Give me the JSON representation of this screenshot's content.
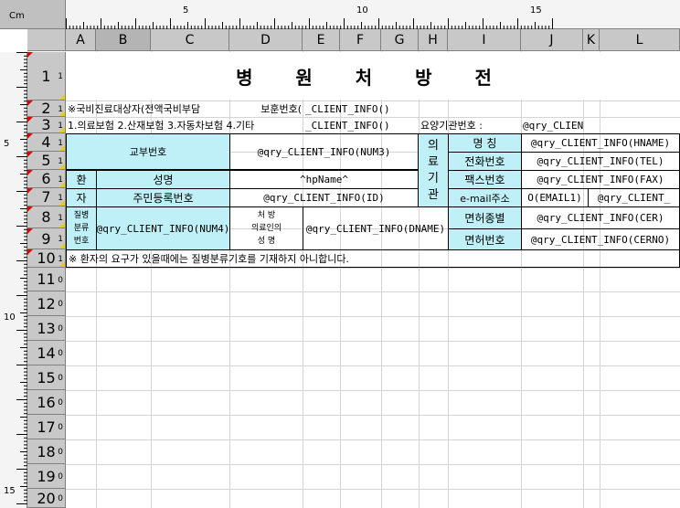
{
  "ruler": {
    "unit_label": "Cm",
    "h_labels": [
      "5",
      "10",
      "15"
    ],
    "v_labels": [
      "5",
      "10",
      "15"
    ]
  },
  "columns": [
    "A",
    "B",
    "C",
    "D",
    "E",
    "F",
    "G",
    "H",
    "I",
    "J",
    "K",
    "L"
  ],
  "active_column": "B",
  "rows": [
    {
      "label": "1",
      "sup": "1"
    },
    {
      "label": "2",
      "sup": "1"
    },
    {
      "label": "3",
      "sup": "1"
    },
    {
      "label": "4",
      "sup": "1"
    },
    {
      "label": "5",
      "sup": "1"
    },
    {
      "label": "6",
      "sup": "1"
    },
    {
      "label": "7",
      "sup": "1"
    },
    {
      "label": "8",
      "sup": "1"
    },
    {
      "label": "9",
      "sup": "1"
    },
    {
      "label": "10",
      "sup": "1"
    },
    {
      "label": "11",
      "sup": "0"
    },
    {
      "label": "12",
      "sup": "0"
    },
    {
      "label": "13",
      "sup": "0"
    },
    {
      "label": "14",
      "sup": "0"
    },
    {
      "label": "15",
      "sup": "0"
    },
    {
      "label": "16",
      "sup": "0"
    },
    {
      "label": "17",
      "sup": "0"
    },
    {
      "label": "18",
      "sup": "0"
    },
    {
      "label": "19",
      "sup": "0"
    },
    {
      "label": "20",
      "sup": "0"
    }
  ],
  "sheet": {
    "title": "병 원 처 방 전",
    "r2_a": "※국비진료대상자(전액국비부담",
    "r2_d_label": "보훈번호(",
    "r2_e": "_CLIENT_INFO(N",
    "r2_g": ")",
    "r3_a": "1.의료보험  2.산재보험  3.자동차보험  4.기타",
    "r3_e": "_CLIENT_INFO(N",
    "r3_g": ")",
    "r3_h": "요양기관번호 :",
    "r3_j": "@qry_CLIEN",
    "gyobu_label": "교부번호",
    "gyobu_value": "@qry_CLIENT_INFO(NUM3)",
    "inst_label": "의\n료\n기\n관",
    "inst_name_label": "명      칭",
    "inst_name_value": "@qry_CLIENT_INFO(HNAME)",
    "inst_tel_label": "전화번호",
    "inst_tel_value": "@qry_CLIENT_INFO(TEL)",
    "inst_fax_label": "팩스번호",
    "inst_fax_value": "@qry_CLIENT_INFO(FAX)",
    "inst_email_label": "e-mail주소",
    "inst_email_value1": "O(EMAIL1)",
    "inst_email_value2": "@qry_CLIENT_",
    "patient_label1": "환",
    "patient_label2": "자",
    "name_label": "성명",
    "name_value": "^hpName^",
    "rrn_label": "주민등록번호",
    "rrn_value": "@qry_CLIENT_INFO(ID)",
    "disease_label": "질병\n분류\n번호",
    "disease_value": "@qry_CLIENT_INFO(NUM4)",
    "doctor_label": "처      방\n의료인의\n성      명",
    "doctor_value": "@qry_CLIENT_INFO(DNAME)",
    "license_type_label": "면허종별",
    "license_type_value": "@qry_CLIENT_INFO(CER)",
    "license_no_label": "면허번호",
    "license_no_value": "@qry_CLIENT_INFO(CERNO)",
    "r10_note": "※ 환자의 요구가 있을때에는 질병분류기호를 기재하지 아니합니다."
  },
  "colors": {
    "cyan_fill": "#bff0f7",
    "header_gray": "#c8c8c8",
    "marker_red": "#dd0000",
    "marker_yellow": "#e8d000"
  }
}
